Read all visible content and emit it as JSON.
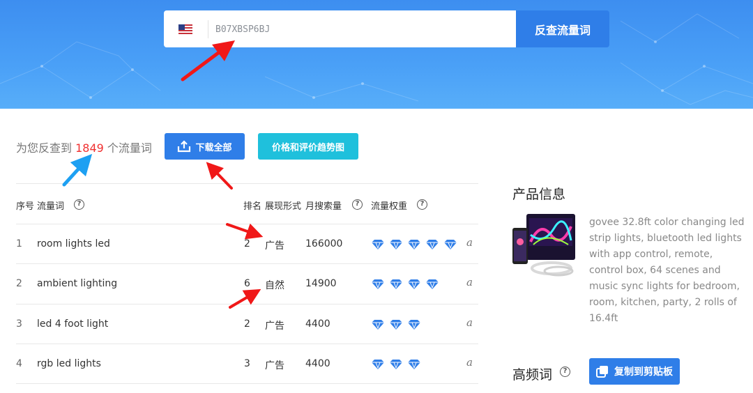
{
  "search": {
    "country_icon": "us-flag-icon",
    "value": "B07XBSP6BJ",
    "button_label": "反查流量词"
  },
  "results": {
    "prefix": "为您反查到 ",
    "count": "1849",
    "suffix": " 个流量词",
    "download_label": "下载全部",
    "trend_label": "价格和评价趋势图"
  },
  "table": {
    "headers": {
      "index": "序号",
      "keyword": "流量词",
      "rank": "排名",
      "display": "展现形式",
      "volume": "月搜索量",
      "weight": "流量权重"
    },
    "rows": [
      {
        "index": "1",
        "keyword": "room lights led",
        "rank": "2",
        "display": "广告",
        "volume": "166000",
        "weight": 5
      },
      {
        "index": "2",
        "keyword": "ambient lighting",
        "rank": "6",
        "display": "自然",
        "volume": "14900",
        "weight": 4
      },
      {
        "index": "3",
        "keyword": "led 4 foot light",
        "rank": "2",
        "display": "广告",
        "volume": "4400",
        "weight": 3
      },
      {
        "index": "4",
        "keyword": "rgb led lights",
        "rank": "3",
        "display": "广告",
        "volume": "4400",
        "weight": 3
      }
    ],
    "amazon_glyph": "a"
  },
  "product": {
    "title": "产品信息",
    "description": "govee 32.8ft color changing led strip lights, bluetooth led lights with app control, remote, control box, 64 scenes and music sync lights for bedroom, room, kitchen, party, 2 rolls of 16.4ft"
  },
  "high_freq": {
    "title": "高频词",
    "copy_label": "复制到剪贴板"
  },
  "colors": {
    "primary": "#2f7ee8",
    "accent_cyan": "#1fc0dc",
    "count_red": "#f03030",
    "gem_blue": "#2f7ee8",
    "annotation_arrow_red": "#f01818",
    "annotation_arrow_blue": "#1da0f2"
  }
}
